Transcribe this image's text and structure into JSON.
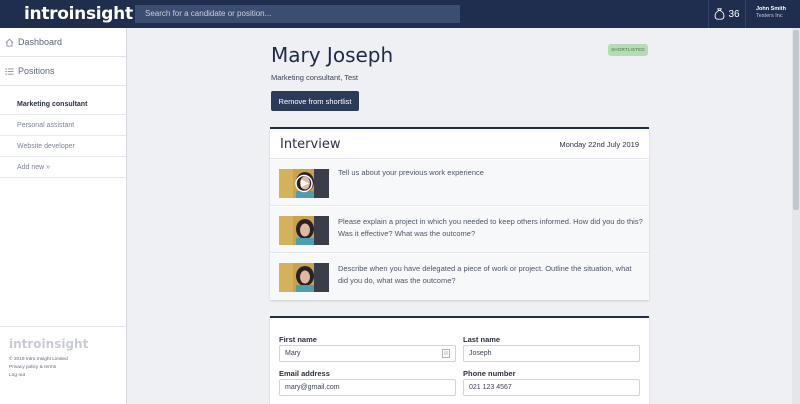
{
  "header": {
    "logo": "introinsight",
    "search_placeholder": "Search for a candidate or position...",
    "credits": "36",
    "user_name": "John Smith",
    "user_company": "Testers Inc"
  },
  "sidebar": {
    "dashboard": "Dashboard",
    "positions": "Positions",
    "items": [
      {
        "label": "Marketing consultant"
      },
      {
        "label": "Personal assistant"
      },
      {
        "label": "Website developer"
      },
      {
        "label": "Add new »"
      }
    ],
    "footer": {
      "logo": "introinsight",
      "copyright": "© 2019 Intro Insight Limited",
      "privacy": "Privacy policy & terms",
      "logout": "Log out"
    }
  },
  "candidate": {
    "name": "Mary Joseph",
    "subtitle": "Marketing consultant, Test",
    "status_badge": "SHORTLISTED",
    "remove_button": "Remove from shortlist"
  },
  "interview": {
    "title": "Interview",
    "date": "Monday 22nd July 2019",
    "questions": [
      {
        "text": "Tell us about your previous work experience"
      },
      {
        "text": "Please explain a project in which you needed to keep others informed. How did you do this? Was it effective? What was the outcome?"
      },
      {
        "text": "Describe when you have delegated a piece of work or project. Outline the situation, what did you do, what was the outcome?"
      }
    ]
  },
  "form": {
    "first_name_label": "First name",
    "first_name_value": "Mary",
    "last_name_label": "Last name",
    "last_name_value": "Joseph",
    "email_label": "Email address",
    "email_value": "mary@gmail.com",
    "phone_label": "Phone number",
    "phone_value": "021 123 4567"
  }
}
